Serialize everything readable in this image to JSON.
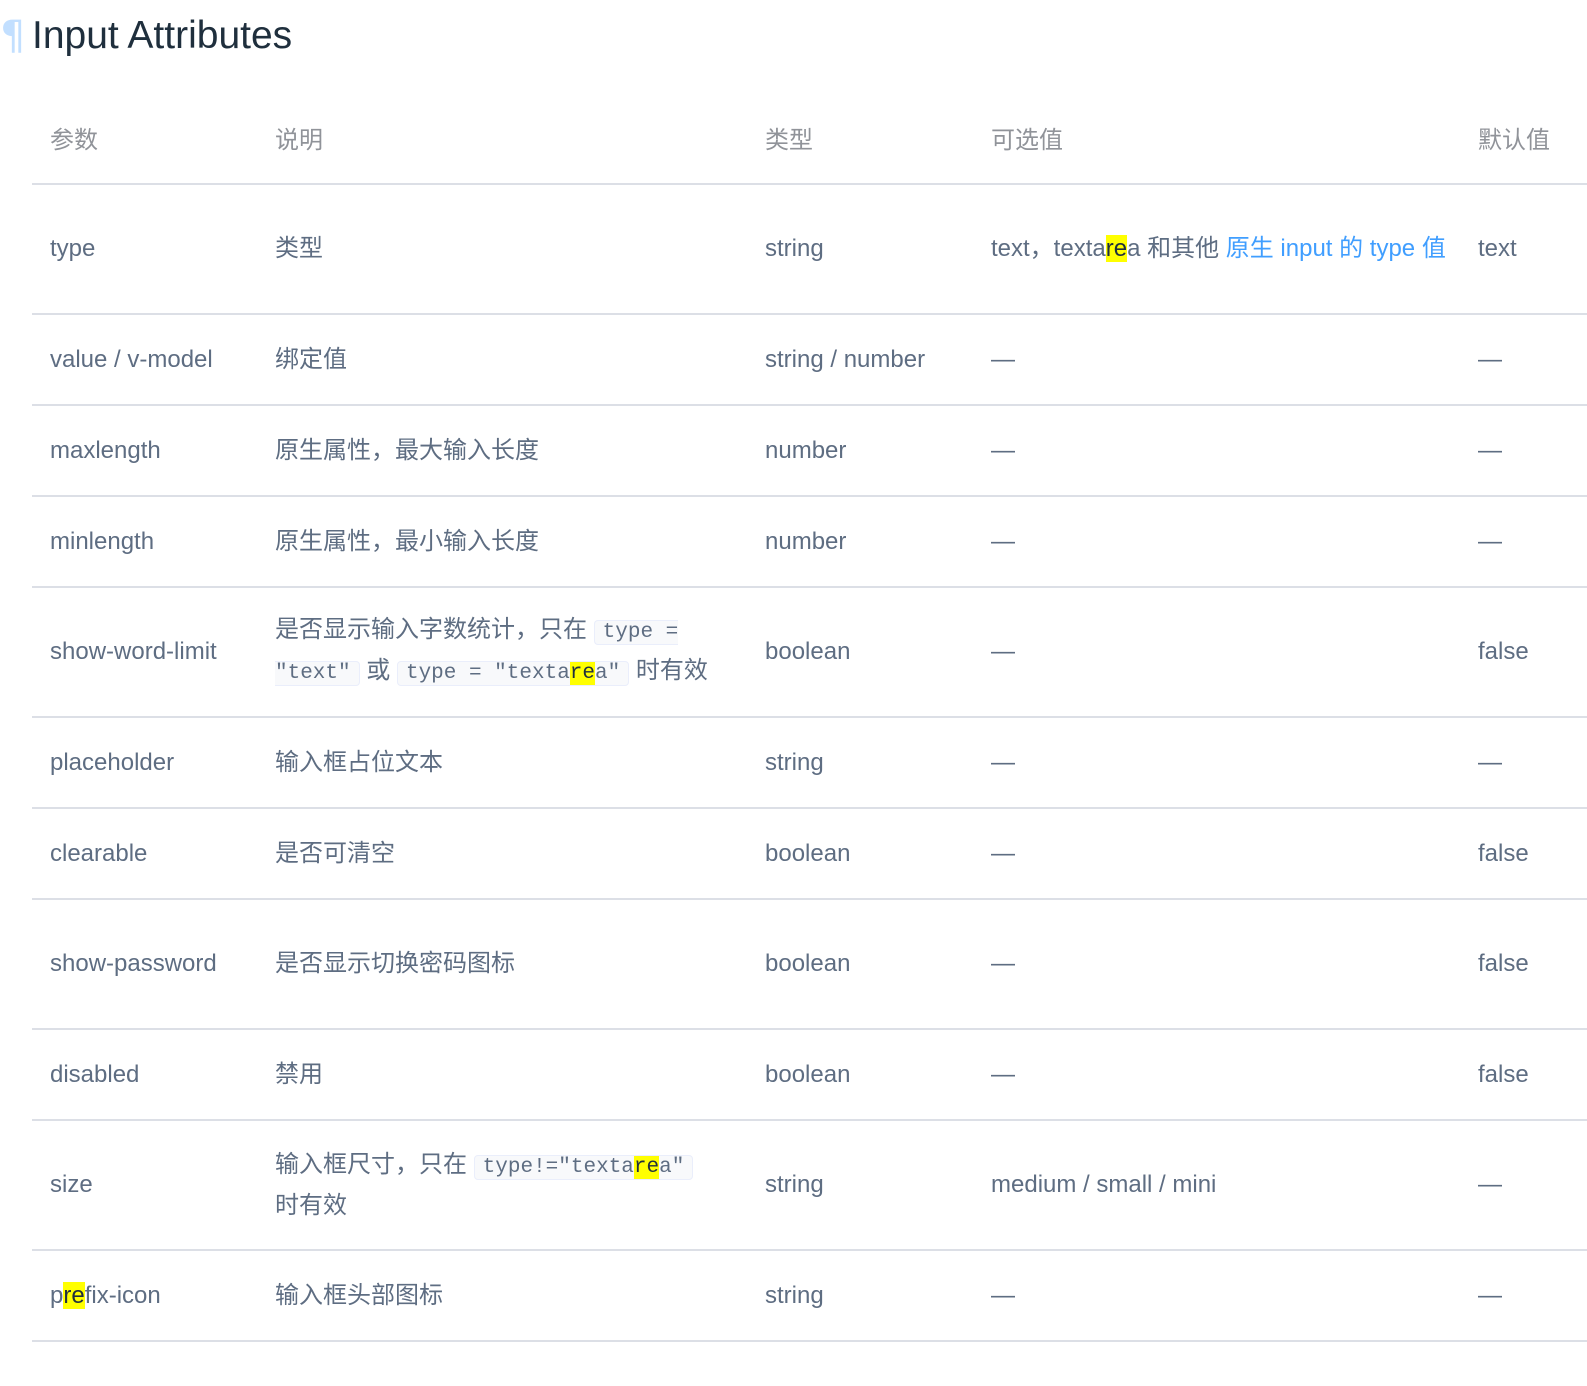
{
  "section": {
    "title": "Input Attributes",
    "anchor_icon": "paragraph-anchor-icon"
  },
  "table": {
    "headers": [
      "参数",
      "说明",
      "类型",
      "可选值",
      "默认值"
    ],
    "rows": [
      {
        "param": "type",
        "desc": "类型",
        "type": "string",
        "options_pre": "text，texta",
        "options_mark": "re",
        "options_post": "a 和其他",
        "options_link": "原生 input 的 type 值",
        "default": "text"
      },
      {
        "param": "value / v-model",
        "desc": "绑定值",
        "type": "string / number",
        "options": "—",
        "default": "—"
      },
      {
        "param": "maxlength",
        "desc": "原生属性，最大输入长度",
        "type": "number",
        "options": "—",
        "default": "—"
      },
      {
        "param": "minlength",
        "desc": "原生属性，最小输入长度",
        "type": "number",
        "options": "—",
        "default": "—"
      },
      {
        "param": "show-word-limit",
        "desc_pre": "是否显示输入字数统计，只在",
        "desc_code1": "type = ″text″",
        "desc_mid": "或",
        "desc_code2_pre": "type = ″texta",
        "desc_code2_mark": "re",
        "desc_code2_post": "a″",
        "desc_post": "时有效",
        "type": "boolean",
        "options": "—",
        "default": "false"
      },
      {
        "param": "placeholder",
        "desc": "输入框占位文本",
        "type": "string",
        "options": "—",
        "default": "—"
      },
      {
        "param": "clearable",
        "desc": "是否可清空",
        "type": "boolean",
        "options": "—",
        "default": "false"
      },
      {
        "param": "show-password",
        "desc": "是否显示切换密码图标",
        "type": "boolean",
        "options": "—",
        "default": "false"
      },
      {
        "param": "disabled",
        "desc": "禁用",
        "type": "boolean",
        "options": "—",
        "default": "false"
      },
      {
        "param": "size",
        "desc_pre": "输入框尺寸，只在",
        "desc_code_pre": "type!=″texta",
        "desc_code_mark": "re",
        "desc_code_post": "a″",
        "desc_post": "时有效",
        "type": "string",
        "options": "medium / small / mini",
        "default": "—"
      },
      {
        "param_pre": "p",
        "param_mark": "re",
        "param_post": "fix-icon",
        "desc": "输入框头部图标",
        "type": "string",
        "options": "—",
        "default": "—"
      }
    ]
  },
  "colors": {
    "heading": "#1f2f3d",
    "text": "#5e6d82",
    "header_text": "#909399",
    "link": "#409eff",
    "highlight": "#ffff00",
    "border": "#dcdfe6"
  }
}
